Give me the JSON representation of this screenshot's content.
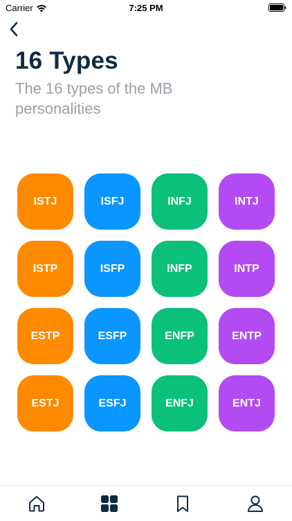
{
  "status_bar": {
    "carrier": "Carrier",
    "time": "7:25 PM"
  },
  "header": {
    "title": "16 Types",
    "subtitle": "The 16 types of the MB personalities"
  },
  "colors": {
    "orange": "#ff8a00",
    "blue": "#0a95ff",
    "green": "#0bc07a",
    "purple": "#b34af2",
    "title": "#0f2a44",
    "subtitle": "#9aa0a6"
  },
  "types": [
    {
      "label": "ISTJ",
      "color": "#ff8a00"
    },
    {
      "label": "ISFJ",
      "color": "#0a95ff"
    },
    {
      "label": "INFJ",
      "color": "#0bc07a"
    },
    {
      "label": "INTJ",
      "color": "#b34af2"
    },
    {
      "label": "ISTP",
      "color": "#ff8a00"
    },
    {
      "label": "ISFP",
      "color": "#0a95ff"
    },
    {
      "label": "INFP",
      "color": "#0bc07a"
    },
    {
      "label": "INTP",
      "color": "#b34af2"
    },
    {
      "label": "ESTP",
      "color": "#ff8a00"
    },
    {
      "label": "ESFP",
      "color": "#0a95ff"
    },
    {
      "label": "ENFP",
      "color": "#0bc07a"
    },
    {
      "label": "ENTP",
      "color": "#b34af2"
    },
    {
      "label": "ESTJ",
      "color": "#ff8a00"
    },
    {
      "label": "ESFJ",
      "color": "#0a95ff"
    },
    {
      "label": "ENFJ",
      "color": "#0bc07a"
    },
    {
      "label": "ENTJ",
      "color": "#b34af2"
    }
  ],
  "tab_bar": {
    "tabs": [
      {
        "icon": "home-icon",
        "selected": false
      },
      {
        "icon": "grid-icon",
        "selected": true
      },
      {
        "icon": "bookmark-icon",
        "selected": false
      },
      {
        "icon": "profile-icon",
        "selected": false
      }
    ]
  }
}
